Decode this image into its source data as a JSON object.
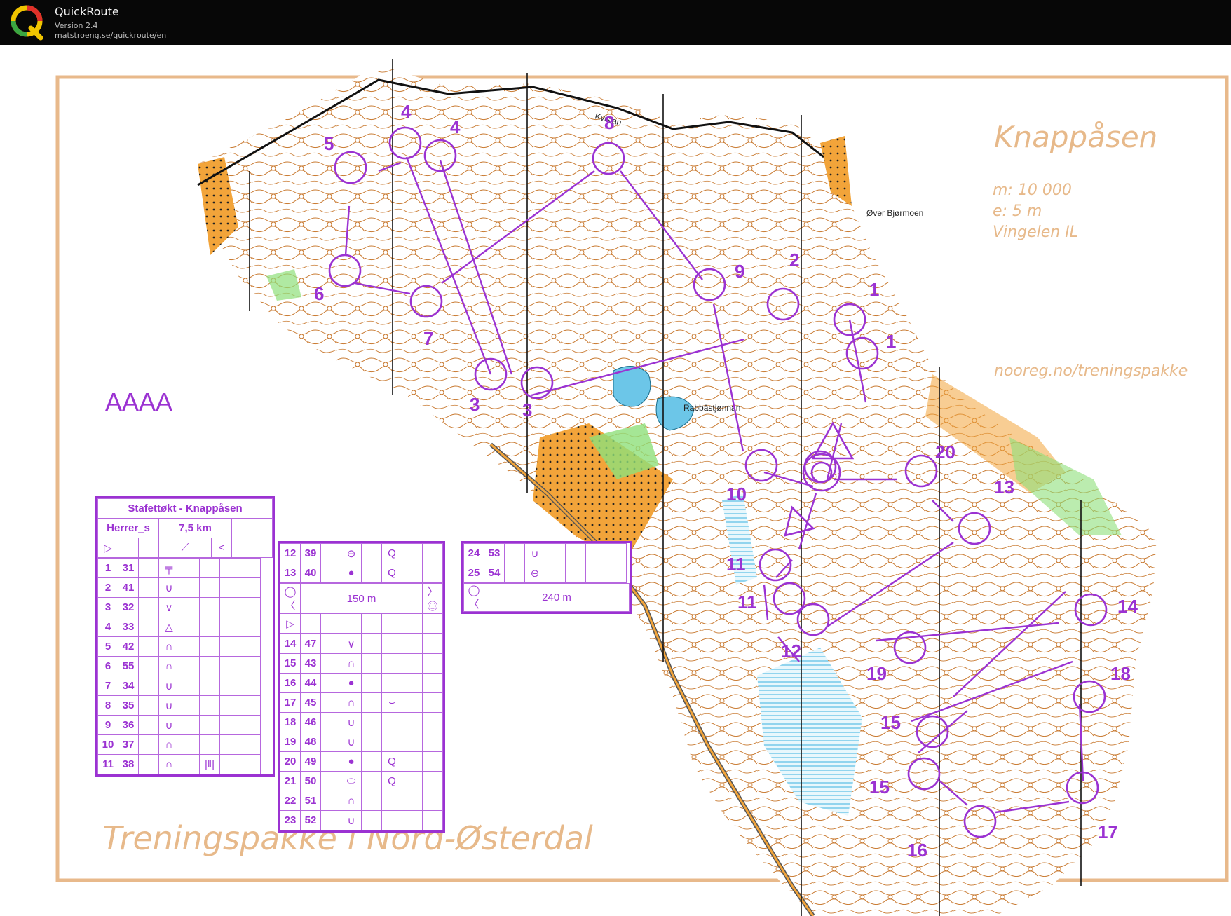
{
  "window": {
    "app_name": "QuickRoute",
    "version": "Version 2.4",
    "url": "matstroeng.se/quickroute/en",
    "logo_letter": "Q"
  },
  "map": {
    "title": "Knappåsen",
    "scale": "m: 10 000",
    "equidistance": "e: 5 m",
    "club": "Vingelen IL",
    "website": "nooreg.no/treningspakke",
    "course_label": "AAAA",
    "footer_title": "Treningspakke i Nord-Østerdal",
    "place_names": [
      "Øver Bjørmoen",
      "Rabbåstjønnan",
      "Kvislan"
    ],
    "control_labels": [
      "1",
      "1",
      "2",
      "3",
      "3",
      "4",
      "4",
      "5",
      "6",
      "7",
      "8",
      "9",
      "10",
      "11",
      "11",
      "12",
      "13",
      "14",
      "15",
      "15",
      "16",
      "17",
      "18",
      "19",
      "20"
    ],
    "colors": {
      "overprint": "#9b32d2",
      "contour": "#c8782e",
      "open_land": "#f2a43a",
      "water": "#6cc6e8",
      "green": "#8ee07a",
      "text_beige": "#e7b98a"
    }
  },
  "description_sheet": {
    "title": "Stafettøkt - Knappåsen",
    "class": "Herrer_s",
    "length": "7,5 km",
    "start_symbol": "▷",
    "rows_part1": [
      {
        "n": "1",
        "code": "31",
        "sym": "╤",
        "sym2": ""
      },
      {
        "n": "2",
        "code": "41",
        "sym": "∪",
        "sym2": ""
      },
      {
        "n": "3",
        "code": "32",
        "sym": "∨",
        "sym2": ""
      },
      {
        "n": "4",
        "code": "33",
        "sym": "△",
        "sym2": ""
      },
      {
        "n": "5",
        "code": "42",
        "sym": "∩",
        "sym2": ""
      },
      {
        "n": "6",
        "code": "55",
        "sym": "∩",
        "sym2": ""
      },
      {
        "n": "7",
        "code": "34",
        "sym": "∪",
        "sym2": ""
      },
      {
        "n": "8",
        "code": "35",
        "sym": "∪",
        "sym2": ""
      },
      {
        "n": "9",
        "code": "36",
        "sym": "∪",
        "sym2": ""
      },
      {
        "n": "10",
        "code": "37",
        "sym": "∩",
        "sym2": ""
      },
      {
        "n": "11",
        "code": "38",
        "sym": "∩",
        "sym2": "|‖|"
      }
    ],
    "rows_part2a": [
      {
        "n": "12",
        "code": "39",
        "sym": "⊖",
        "sym2": "Q"
      },
      {
        "n": "13",
        "code": "40",
        "sym": "●",
        "sym2": "Q"
      }
    ],
    "leg_150": "150 m",
    "rows_part2b": [
      {
        "n": "14",
        "code": "47",
        "sym": "∨",
        "sym2": ""
      },
      {
        "n": "15",
        "code": "43",
        "sym": "∩",
        "sym2": ""
      },
      {
        "n": "16",
        "code": "44",
        "sym": "●",
        "sym2": ""
      },
      {
        "n": "17",
        "code": "45",
        "sym": "∩",
        "sym2": "⌣"
      },
      {
        "n": "18",
        "code": "46",
        "sym": "∪",
        "sym2": ""
      },
      {
        "n": "19",
        "code": "48",
        "sym": "∪",
        "sym2": ""
      },
      {
        "n": "20",
        "code": "49",
        "sym": "●",
        "sym2": "Q"
      },
      {
        "n": "21",
        "code": "50",
        "sym": "⬭",
        "sym2": "Q"
      },
      {
        "n": "22",
        "code": "51",
        "sym": "∩",
        "sym2": ""
      },
      {
        "n": "23",
        "code": "52",
        "sym": "∪",
        "sym2": ""
      }
    ],
    "rows_part3": [
      {
        "n": "24",
        "code": "53",
        "sym": "∪",
        "sym2": ""
      },
      {
        "n": "25",
        "code": "54",
        "sym": "⊖",
        "sym2": ""
      }
    ],
    "leg_240": "240 m",
    "finish_symbol": "◯〈",
    "finish_end": "◎"
  }
}
